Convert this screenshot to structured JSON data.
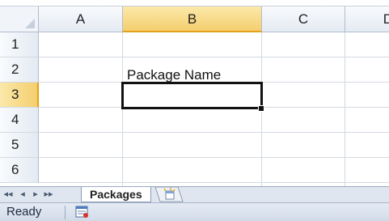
{
  "spreadsheet": {
    "columns": [
      {
        "label": "A"
      },
      {
        "label": "B"
      },
      {
        "label": "C"
      },
      {
        "label": "D"
      }
    ],
    "rows": [
      {
        "label": "1"
      },
      {
        "label": "2"
      },
      {
        "label": "3"
      },
      {
        "label": "4"
      },
      {
        "label": "5"
      },
      {
        "label": "6"
      }
    ],
    "cells": {
      "B2": "Package Name",
      "B3": ""
    },
    "active_cell": "B3",
    "colors": {
      "header_active": "#f4cf6f",
      "selection_border": "#111111",
      "gridline": "#d4d9e0"
    }
  },
  "sheet_tabs": {
    "nav_first": "◂◂",
    "nav_prev": "◂",
    "nav_next": "▸",
    "nav_last": "▸▸",
    "tabs": [
      {
        "label": "Packages",
        "active": true
      }
    ],
    "new_sheet_icon": "insert-worksheet-icon"
  },
  "status_bar": {
    "mode": "Ready",
    "macro_icon": "record-macro-icon"
  }
}
